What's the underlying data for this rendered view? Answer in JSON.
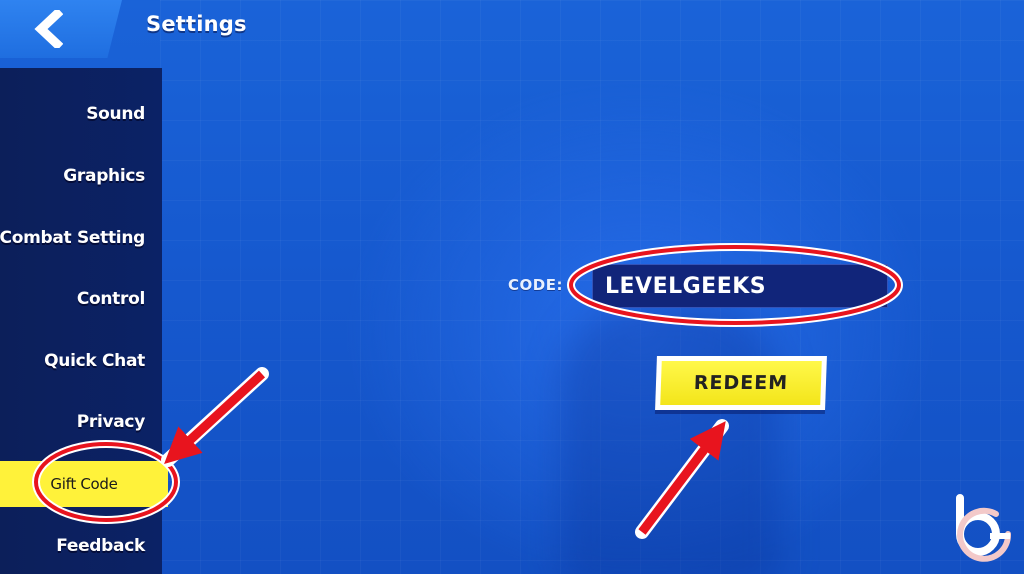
{
  "header": {
    "back_icon": "chevron-left-icon",
    "title": "Settings"
  },
  "sidebar": {
    "items": [
      {
        "label": "Sound",
        "active": false
      },
      {
        "label": "Graphics",
        "active": false
      },
      {
        "label": "Combat Setting",
        "active": false
      },
      {
        "label": "Control",
        "active": false
      },
      {
        "label": "Quick Chat",
        "active": false
      },
      {
        "label": "Privacy",
        "active": false
      },
      {
        "label": "Gift Code",
        "active": true
      },
      {
        "label": "Feedback",
        "active": false
      }
    ]
  },
  "gift_code": {
    "code_label": "CODE:",
    "code_value": "LEVELGEEKS",
    "redeem_label": "REDEEM"
  },
  "colors": {
    "background": "#1659cf",
    "sidebar": "#0c1f5a",
    "active_item": "#fff23a",
    "button": "#fff84a",
    "annotation": "#e8141e"
  }
}
